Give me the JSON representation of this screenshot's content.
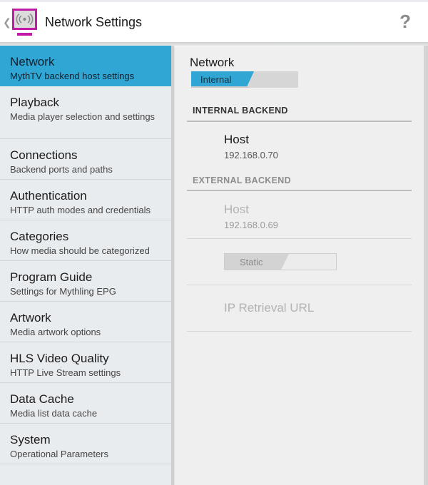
{
  "actionbar": {
    "title": "Network Settings",
    "back_icon": "chevron-left-icon",
    "app_icon": "broadcast-monitor-icon",
    "help_label": "?",
    "brand_color": "#c21aa6"
  },
  "sidebar": {
    "accent_color": "#2fa6d4",
    "items": [
      {
        "label": "Network",
        "sub": "MythTV backend host settings",
        "active": true
      },
      {
        "label": "Playback",
        "sub": "Media player selection and settings",
        "active": false
      },
      {
        "label": "Connections",
        "sub": "Backend ports and paths",
        "active": false
      },
      {
        "label": "Authentication",
        "sub": "HTTP auth modes and credentials",
        "active": false
      },
      {
        "label": "Categories",
        "sub": "How media should be categorized",
        "active": false
      },
      {
        "label": "Program Guide",
        "sub": "Settings for Mythling EPG",
        "active": false
      },
      {
        "label": "Artwork",
        "sub": "Media artwork options",
        "active": false
      },
      {
        "label": "HLS Video Quality",
        "sub": "HTTP Live Stream settings",
        "active": false
      },
      {
        "label": "Data Cache",
        "sub": "Media list data cache",
        "active": false
      },
      {
        "label": "System",
        "sub": "Operational Parameters",
        "active": false
      }
    ]
  },
  "panel": {
    "network": {
      "title": "Network",
      "switch_label": "Internal",
      "switch_on": true
    },
    "internal_backend": {
      "header": "INTERNAL BACKEND",
      "host_label": "Host",
      "host_value": "192.168.0.70"
    },
    "external_backend": {
      "header": "EXTERNAL BACKEND",
      "host_label": "Host",
      "host_value": "192.168.0.69",
      "ip_switch_label": "Static",
      "ip_switch_on": false,
      "ip_retrieval_label": "IP Retrieval URL",
      "enabled": false
    }
  }
}
